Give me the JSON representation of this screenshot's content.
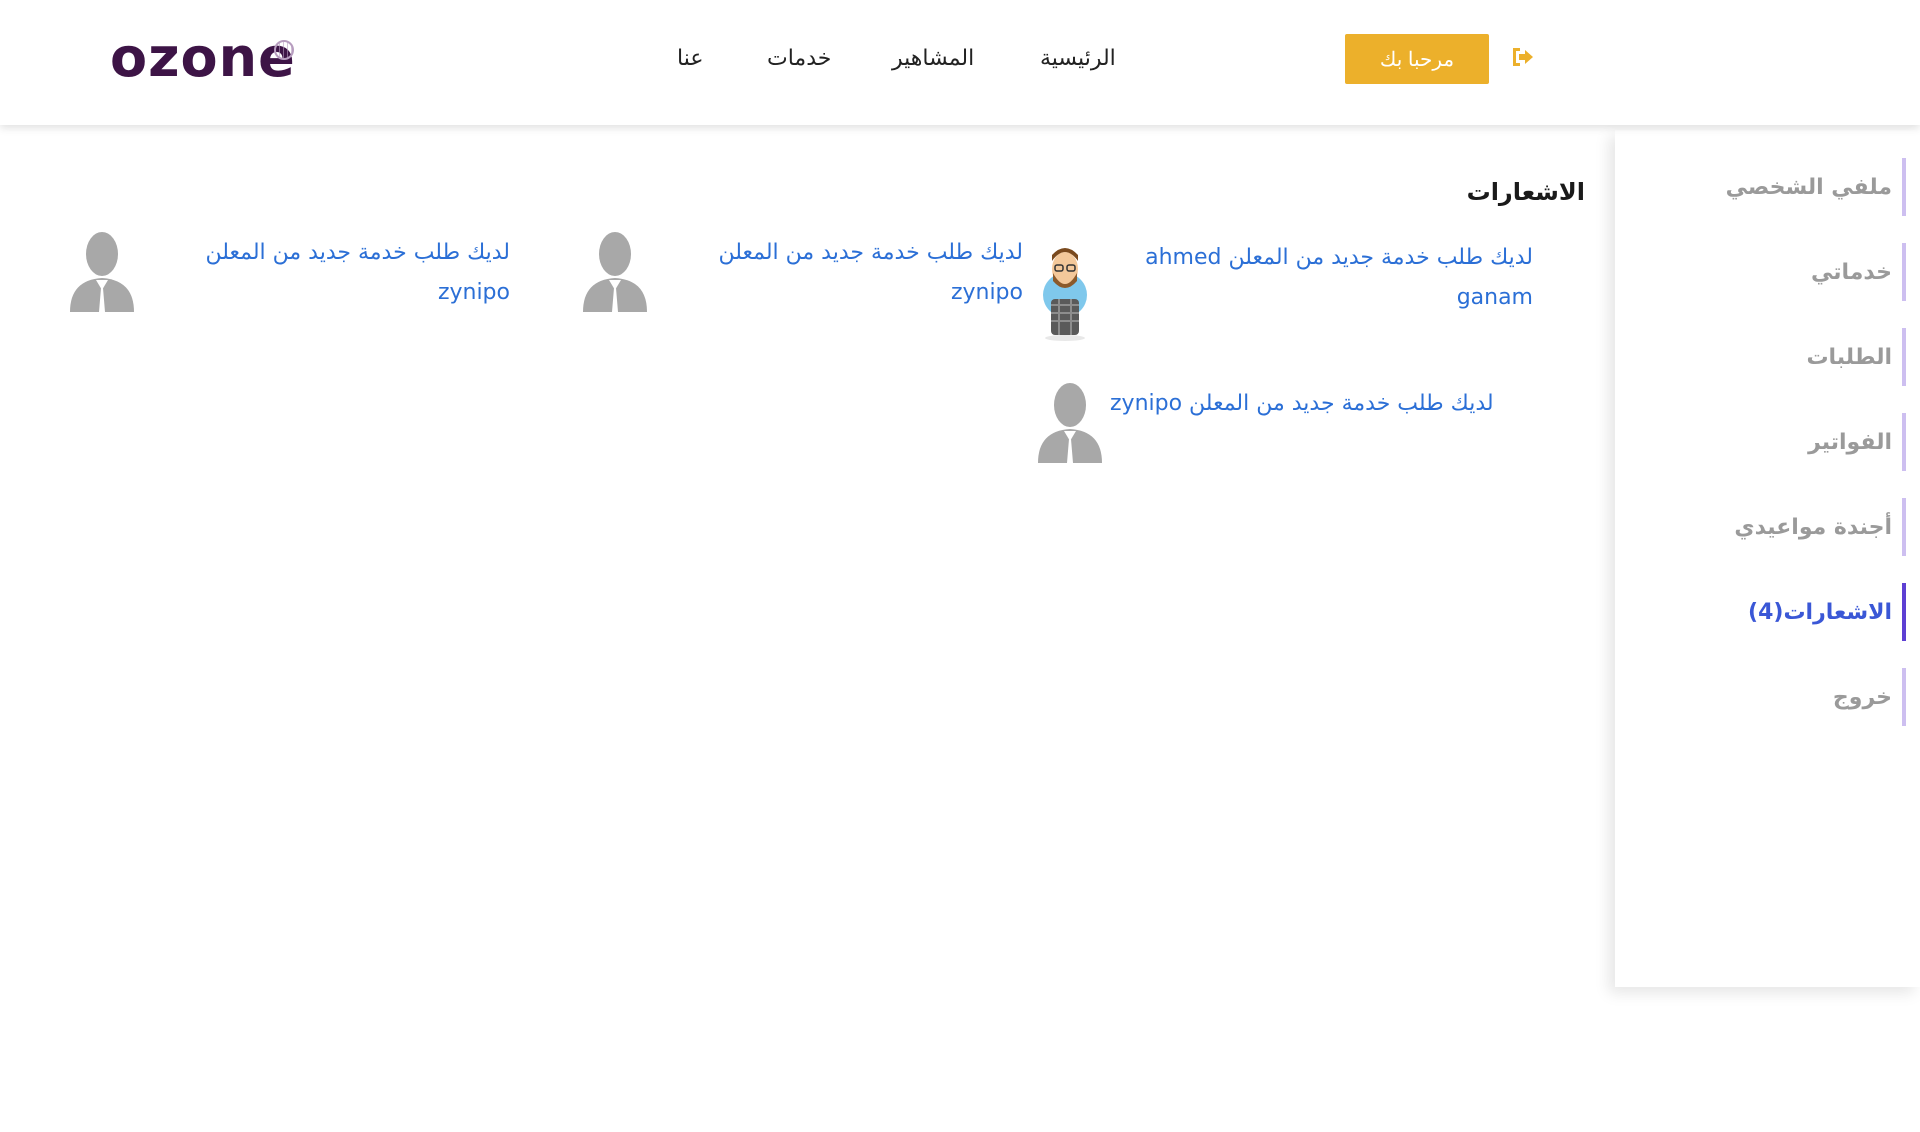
{
  "header": {
    "logo_text": "ozone",
    "nav": {
      "home": "الرئيسية",
      "celebrities": "المشاهير",
      "services": "خدمات",
      "about": "عنا"
    },
    "welcome_button": "مرحبا بك",
    "accent_color": "#ecb02b",
    "logout_icon": "sign-out-icon"
  },
  "sidebar": {
    "items": [
      {
        "label": "ملفي الشخصي"
      },
      {
        "label": "خدماتي"
      },
      {
        "label": "الطلبات"
      },
      {
        "label": "الفواتير"
      },
      {
        "label": "أجندة مواعيدي"
      },
      {
        "label": "الاشعارات(4)"
      },
      {
        "label": "خروج"
      }
    ],
    "active_index": 5,
    "active_color": "#3a57d6"
  },
  "main": {
    "title": "الاشعارات",
    "notifications": [
      {
        "text": "لديك طلب خدمة جديد من المعلن ahmed ganam",
        "avatar": "cartoon-man-avatar-icon"
      },
      {
        "text": "لديك طلب خدمة جديد من المعلن zynipo",
        "avatar": "default-user-avatar-icon"
      },
      {
        "text": "لديك طلب خدمة جديد من المعلن zynipo",
        "avatar": "default-user-avatar-icon"
      },
      {
        "text": "لديك طلب خدمة جديد من المعلن zynipo",
        "avatar": "default-user-avatar-icon"
      }
    ],
    "link_color": "#2b6fd6"
  }
}
